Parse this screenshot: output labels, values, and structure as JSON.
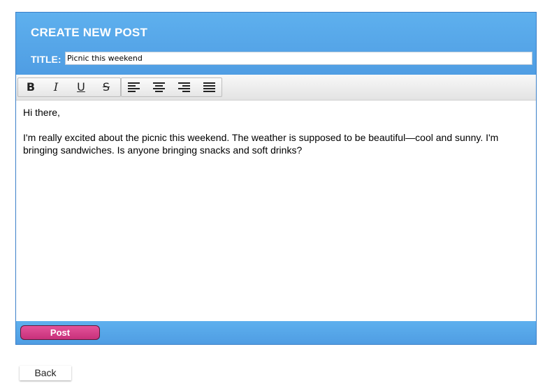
{
  "header": {
    "title": "CREATE NEW POST",
    "title_label": "TITLE:"
  },
  "title_field": {
    "value": "Picnic this weekend"
  },
  "toolbar": {
    "format_buttons": [
      {
        "name": "bold-icon",
        "glyph": "B"
      },
      {
        "name": "italic-icon",
        "glyph": "I"
      },
      {
        "name": "underline-icon",
        "glyph": "U"
      },
      {
        "name": "strikethrough-icon",
        "glyph": "S"
      }
    ],
    "align_buttons": [
      "align-left-icon",
      "align-center-icon",
      "align-right-icon",
      "align-justify-icon"
    ]
  },
  "editor": {
    "greeting": "Hi there,",
    "body": "I'm really excited about the picnic this weekend. The weather is supposed to be beautiful—cool and sunny. I'm bringing sandwiches. Is anyone bringing snacks and soft drinks?"
  },
  "footer": {
    "post_label": "Post"
  },
  "back_label": "Back",
  "colors": {
    "header_blue": "#5eb0ee",
    "post_pink": "#d84188"
  }
}
